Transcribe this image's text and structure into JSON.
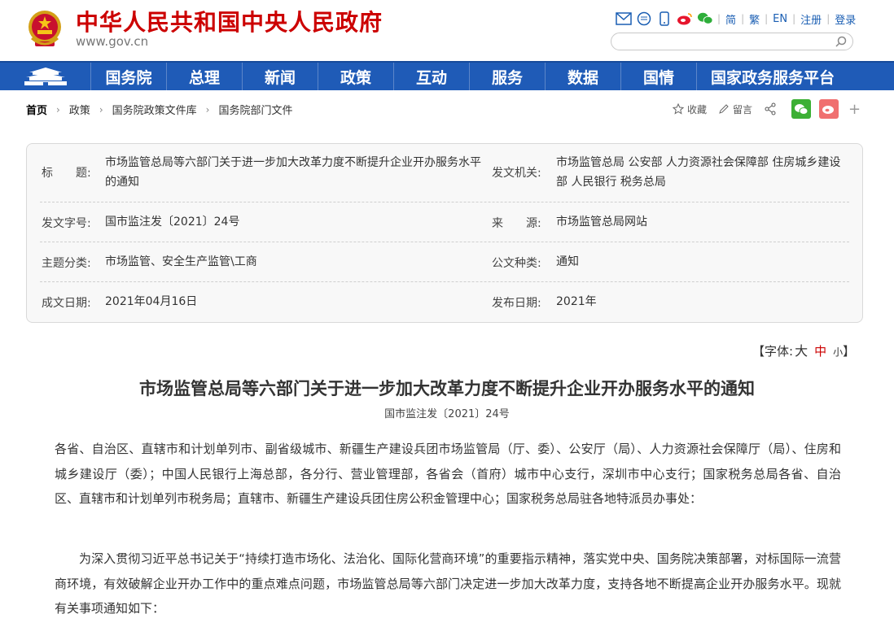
{
  "header": {
    "site_title": "中华人民共和国中央人民政府",
    "site_url": "www.gov.cn",
    "links": [
      "简",
      "繁",
      "EN",
      "注册",
      "登录"
    ],
    "search_placeholder": ""
  },
  "nav": {
    "items": [
      "国务院",
      "总理",
      "新闻",
      "政策",
      "互动",
      "服务",
      "数据",
      "国情",
      "国家政务服务平台"
    ]
  },
  "breadcrumb": {
    "items": [
      "首页",
      "政策",
      "国务院政策文件库",
      "国务院部门文件"
    ]
  },
  "share": {
    "favorite": "收藏",
    "comment": "留言"
  },
  "info": {
    "title_label": "标　　题:",
    "title_value": "市场监管总局等六部门关于进一步加大改革力度不断提升企业开办服务水平的通知",
    "issuer_label": "发文机关:",
    "issuer_value": "市场监管总局 公安部 人力资源社会保障部 住房城乡建设部 人民银行 税务总局",
    "docno_label": "发文字号:",
    "docno_value": "国市监注发〔2021〕24号",
    "source_label": "来　　源:",
    "source_value": "市场监管总局网站",
    "topic_label": "主题分类:",
    "topic_value": "市场监管、安全生产监管\\工商",
    "type_label": "公文种类:",
    "type_value": "通知",
    "date_label": "成文日期:",
    "date_value": "2021年04月16日",
    "pub_label": "发布日期:",
    "pub_value": "2021年"
  },
  "fontsize": {
    "prefix": "【字体:",
    "big": "大",
    "mid": "中",
    "small": "小",
    "suffix": "】"
  },
  "article": {
    "title": "市场监管总局等六部门关于进一步加大改革力度不断提升企业开办服务水平的通知",
    "doc_no": "国市监注发〔2021〕24号",
    "p1": "各省、自治区、直辖市和计划单列市、副省级城市、新疆生产建设兵团市场监管局（厅、委）、公安厅（局）、人力资源社会保障厅（局）、住房和城乡建设厅（委）；中国人民银行上海总部，各分行、营业管理部，各省会（首府）城市中心支行，深圳市中心支行；国家税务总局各省、自治区、直辖市和计划单列市税务局；直辖市、新疆生产建设兵团住房公积金管理中心；国家税务总局驻各地特派员办事处：",
    "p2": "为深入贯彻习近平总书记关于“持续打造市场化、法治化、国际化营商环境”的重要指示精神，落实党中央、国务院决策部署，对标国际一流营商环境，有效破解企业开办工作中的重点难点问题，市场监管总局等六部门决定进一步加大改革力度，支持各地不断提高企业开办服务水平。现就有关事项通知如下："
  },
  "colors": {
    "brand_red": "#cc0000",
    "nav_blue": "#1f5bb7",
    "link_blue": "#1a5eb3"
  }
}
